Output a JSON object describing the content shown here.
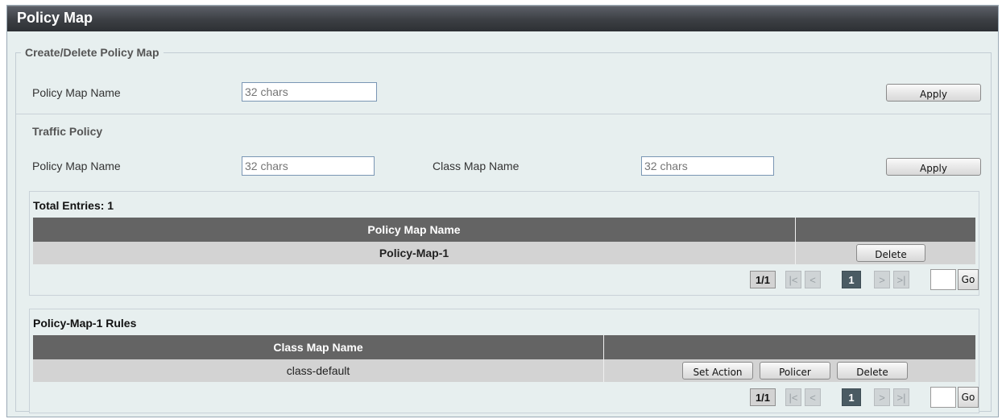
{
  "page": {
    "title": "Policy Map"
  },
  "create_delete": {
    "legend": "Create/Delete Policy Map",
    "policy_map_name_label": "Policy Map Name",
    "policy_map_name_placeholder": "32 chars",
    "apply_label": "Apply"
  },
  "traffic_policy": {
    "heading": "Traffic Policy",
    "policy_map_name_label": "Policy Map Name",
    "policy_map_name_placeholder": "32 chars",
    "class_map_name_label": "Class Map Name",
    "class_map_name_placeholder": "32 chars",
    "apply_label": "Apply"
  },
  "entries_table": {
    "total_label": "Total Entries: 1",
    "columns": [
      "Policy Map Name",
      ""
    ],
    "rows": [
      {
        "name": "Policy-Map-1",
        "delete_label": "Delete"
      }
    ],
    "pager": {
      "total": "1/1",
      "first": "|<",
      "prev": "<",
      "current": "1",
      "next": ">",
      "last": ">|",
      "go": "Go"
    }
  },
  "rules_table": {
    "title": "Policy-Map-1 Rules",
    "columns": [
      "Class Map Name",
      ""
    ],
    "rows": [
      {
        "class_map_name": "class-default",
        "set_action_label": "Set Action",
        "policer_label": "Policer",
        "delete_label": "Delete"
      }
    ],
    "pager": {
      "total": "1/1",
      "first": "|<",
      "prev": "<",
      "current": "1",
      "next": ">",
      "last": ">|",
      "go": "Go"
    }
  },
  "colors": {
    "title_bar": "#3c3f44",
    "panel_bg": "#e7efef",
    "table_header": "#646464",
    "table_row": "#d3d3d3",
    "pager_current": "#4a5b63"
  }
}
